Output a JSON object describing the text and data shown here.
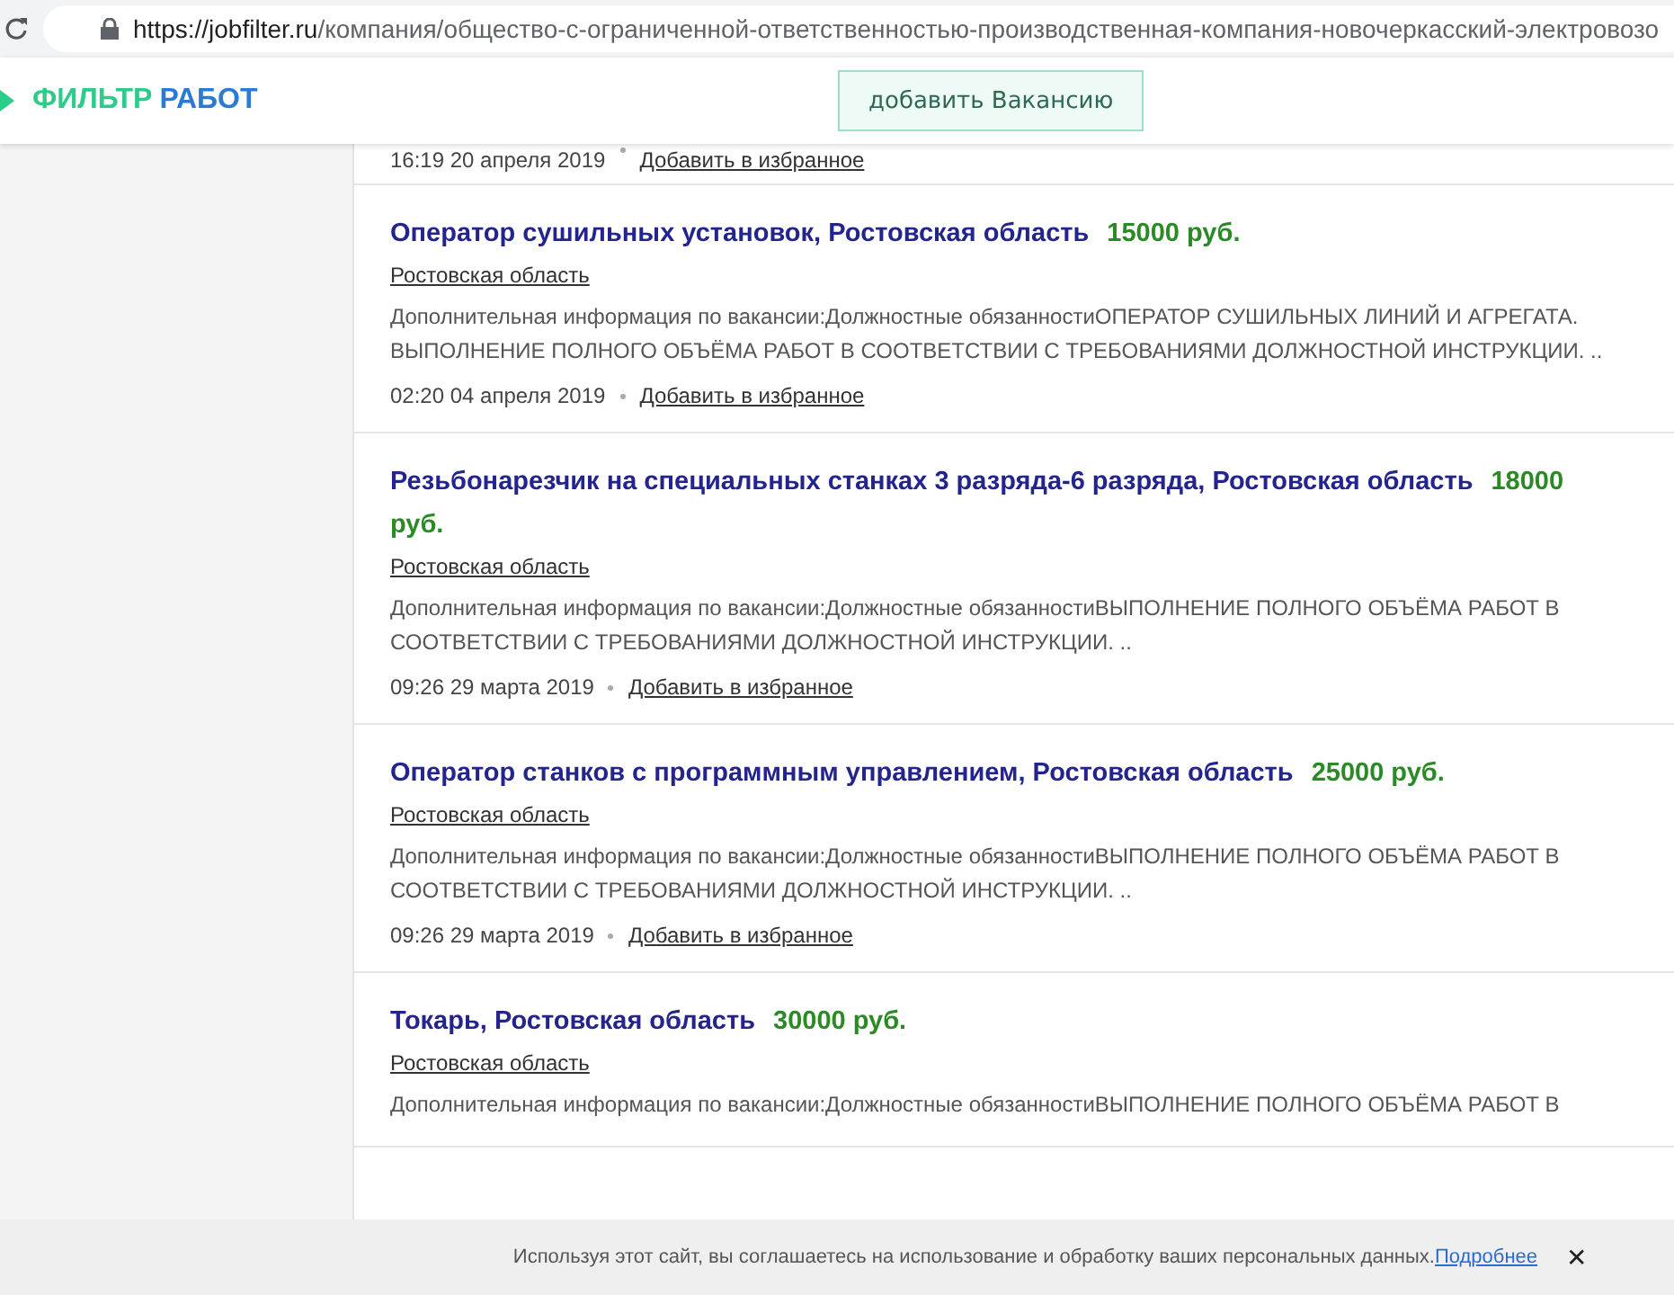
{
  "address_bar": {
    "url_host": "https://jobfilter.ru",
    "url_path": "/компания/общество-с-ограниченной-ответственностью-производственная-компания-новочеркасский-электровозо"
  },
  "header": {
    "logo_part_1": "ФИЛЬТР",
    "logo_part_2": "РАБОТ",
    "add_button": "добавить Вакансию"
  },
  "previous_listing_footer": {
    "date": "16:19 20 апреля 2019",
    "favorite_link": "Добавить в избранное"
  },
  "listings": [
    {
      "title": "Оператор сушильных установок, Ростовская область",
      "salary": "15000 руб.",
      "region": "Ростовская область",
      "description": "Дополнительная информация по вакансии:Должностные обязанностиОПЕРАТОР СУШИЛЬНЫХ ЛИНИЙ И АГРЕГАТА. ВЫПОЛНЕНИЕ ПОЛНОГО ОБЪЁМА РАБОТ В СООТВЕТСТВИИ С ТРЕБОВАНИЯМИ ДОЛЖНОСТНОЙ ИНСТРУКЦИИ. ..",
      "date": "02:20 04 апреля 2019",
      "favorite_link": "Добавить в избранное"
    },
    {
      "title": "Резьбонарезчик на специальных станках 3 разряда-6 разряда, Ростовская область",
      "salary": "18000 руб.",
      "region": "Ростовская область",
      "description": "Дополнительная информация по вакансии:Должностные обязанностиВЫПОЛНЕНИЕ ПОЛНОГО ОБЪЁМА РАБОТ В СООТВЕТСТВИИ С ТРЕБОВАНИЯМИ ДОЛЖНОСТНОЙ ИНСТРУКЦИИ. ..",
      "date": "09:26 29 марта 2019",
      "favorite_link": "Добавить в избранное"
    },
    {
      "title": "Оператор станков с программным управлением, Ростовская область",
      "salary": "25000 руб.",
      "region": "Ростовская область",
      "description": "Дополнительная информация по вакансии:Должностные обязанностиВЫПОЛНЕНИЕ ПОЛНОГО ОБЪЁМА РАБОТ В СООТВЕТСТВИИ С ТРЕБОВАНИЯМИ ДОЛЖНОСТНОЙ ИНСТРУКЦИИ. ..",
      "date": "09:26 29 марта 2019",
      "favorite_link": "Добавить в избранное"
    },
    {
      "title": "Токарь, Ростовская область",
      "salary": "30000 руб.",
      "region": "Ростовская область",
      "description": "Дополнительная информация по вакансии:Должностные обязанностиВЫПОЛНЕНИЕ ПОЛНОГО ОБЪЁМА РАБОТ В"
    }
  ],
  "cookie_banner": {
    "text": "Используя этот сайт, вы соглашаетесь на использование и обработку ваших персональных данных.",
    "link": "Подробнее",
    "close": "✕"
  }
}
